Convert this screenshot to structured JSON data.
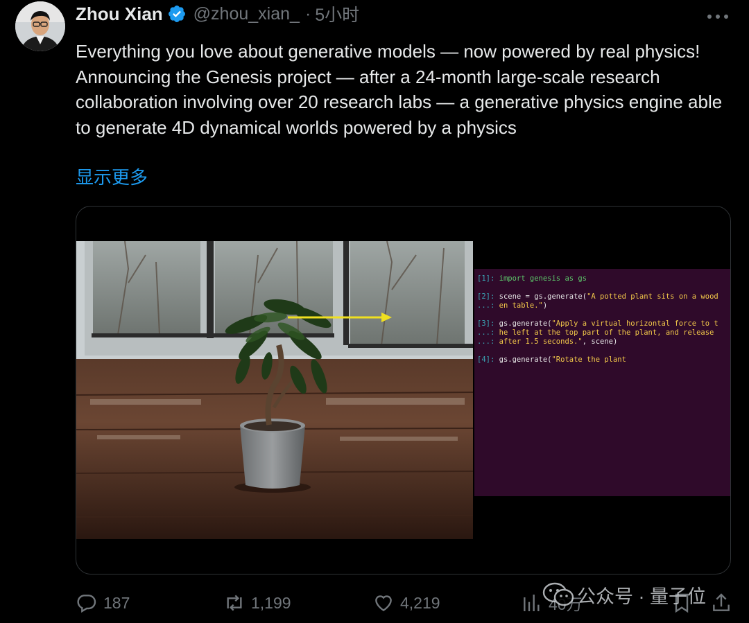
{
  "author": {
    "name": "Zhou Xian",
    "handle": "@zhou_xian_",
    "separator": "·",
    "time": "5小时"
  },
  "tweet": {
    "paragraphs": [
      "Everything you love about generative models — now powered by real physics!",
      "Announcing the Genesis project — after a 24-month large-scale research collaboration involving over 20 research labs — a generative physics engine able to generate 4D dynamical worlds powered by a physics"
    ],
    "show_more": "显示更多"
  },
  "terminal": {
    "lines": [
      {
        "prompt": "[1]:",
        "parts": [
          {
            "t": "kw",
            "v": " import genesis as gs"
          }
        ]
      },
      {
        "gap": true
      },
      {
        "prompt": "[2]:",
        "parts": [
          {
            "t": "plain",
            "v": " scene = gs.generate("
          },
          {
            "t": "str",
            "v": "\"A potted plant sits on a wood"
          }
        ]
      },
      {
        "prompt": "...:",
        "parts": [
          {
            "t": "str",
            "v": " en table.\""
          },
          {
            "t": "plain",
            "v": ")"
          }
        ]
      },
      {
        "gap": true
      },
      {
        "prompt": "[3]:",
        "parts": [
          {
            "t": "plain",
            "v": " gs.generate("
          },
          {
            "t": "str",
            "v": "\"Apply a virtual horizontal force to t"
          }
        ]
      },
      {
        "prompt": "...:",
        "parts": [
          {
            "t": "str",
            "v": " he left at the top part of the plant, and release"
          }
        ]
      },
      {
        "prompt": "...:",
        "parts": [
          {
            "t": "str",
            "v": " after 1.5 seconds.\""
          },
          {
            "t": "plain",
            "v": ", scene)"
          }
        ]
      },
      {
        "gap": true
      },
      {
        "prompt": "[4]:",
        "parts": [
          {
            "t": "plain",
            "v": " gs.generate("
          },
          {
            "t": "str",
            "v": "\"Rotate the plant"
          }
        ]
      }
    ]
  },
  "actions": {
    "replies": "187",
    "reposts": "1,199",
    "likes": "4,219",
    "views": "40万"
  },
  "watermark": {
    "text": "公众号 · 量子位"
  },
  "colors": {
    "link": "#1d9bf0",
    "verified": "#1d9bf0",
    "terminal_bg": "#2f0a2a",
    "muted": "#71767b"
  }
}
